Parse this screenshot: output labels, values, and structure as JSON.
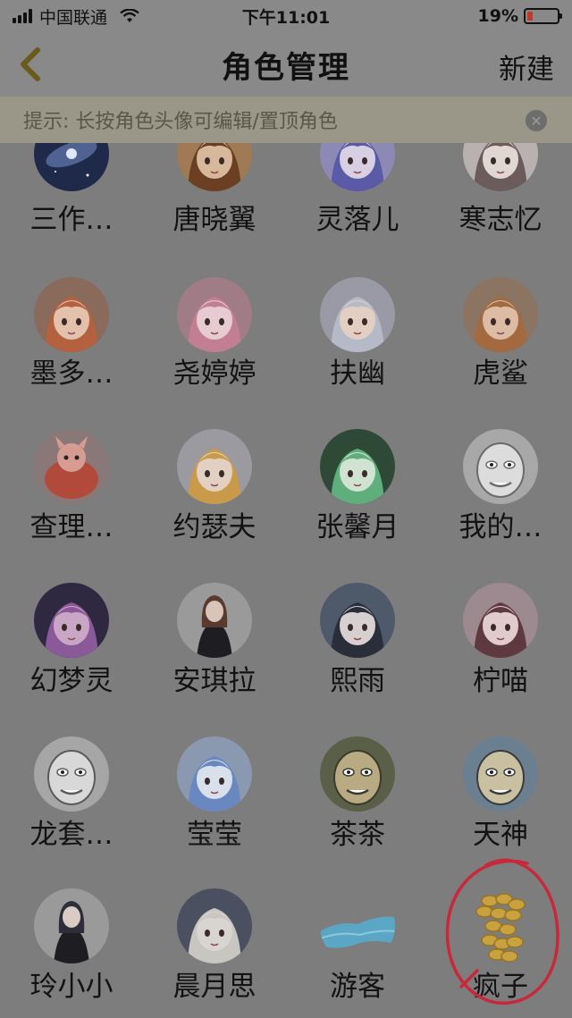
{
  "status_bar": {
    "carrier": "中国联通",
    "time": "下午11:01",
    "battery": "19%",
    "battery_level": 0.19
  },
  "nav": {
    "title": "角色管理",
    "new_label": "新建"
  },
  "tip": {
    "text": "提示: 长按角色头像可编辑/置顶角色",
    "close_icon": "close-icon"
  },
  "roles": [
    {
      "name": "三作…",
      "avatar": "galaxy"
    },
    {
      "name": "唐晓翼",
      "avatar": "anime-boy"
    },
    {
      "name": "灵落儿",
      "avatar": "blue-hair-girl"
    },
    {
      "name": "寒志忆",
      "avatar": "sketch-boy"
    },
    {
      "name": "墨多…",
      "avatar": "orange-hair-kid"
    },
    {
      "name": "尧婷婷",
      "avatar": "pink-hair-girl"
    },
    {
      "name": "扶幽",
      "avatar": "silver-hair-kid"
    },
    {
      "name": "虎鲨",
      "avatar": "bun-hair-kid"
    },
    {
      "name": "查理…",
      "avatar": "red-creature"
    },
    {
      "name": "约瑟夫",
      "avatar": "blonde-boy"
    },
    {
      "name": "张馨月",
      "avatar": "green-fairy"
    },
    {
      "name": "我的…",
      "avatar": "meme-face"
    },
    {
      "name": "幻梦灵",
      "avatar": "purple-fantasy"
    },
    {
      "name": "安琪拉",
      "avatar": "black-dress-girl"
    },
    {
      "name": "熙雨",
      "avatar": "dark-hair-girl"
    },
    {
      "name": "柠喵",
      "avatar": "long-hair-girl"
    },
    {
      "name": "龙套…",
      "avatar": "rabbit-sketch"
    },
    {
      "name": "莹莹",
      "avatar": "blue-magical-girl"
    },
    {
      "name": "茶茶",
      "avatar": "crying-face"
    },
    {
      "name": "天神",
      "avatar": "rage-face"
    },
    {
      "name": "玲小小",
      "avatar": "chibi-girl"
    },
    {
      "name": "晨月思",
      "avatar": "white-hair-girl"
    },
    {
      "name": "游客",
      "avatar": "blue-sea"
    },
    {
      "name": "疯子",
      "avatar": "gold-coins"
    }
  ]
}
